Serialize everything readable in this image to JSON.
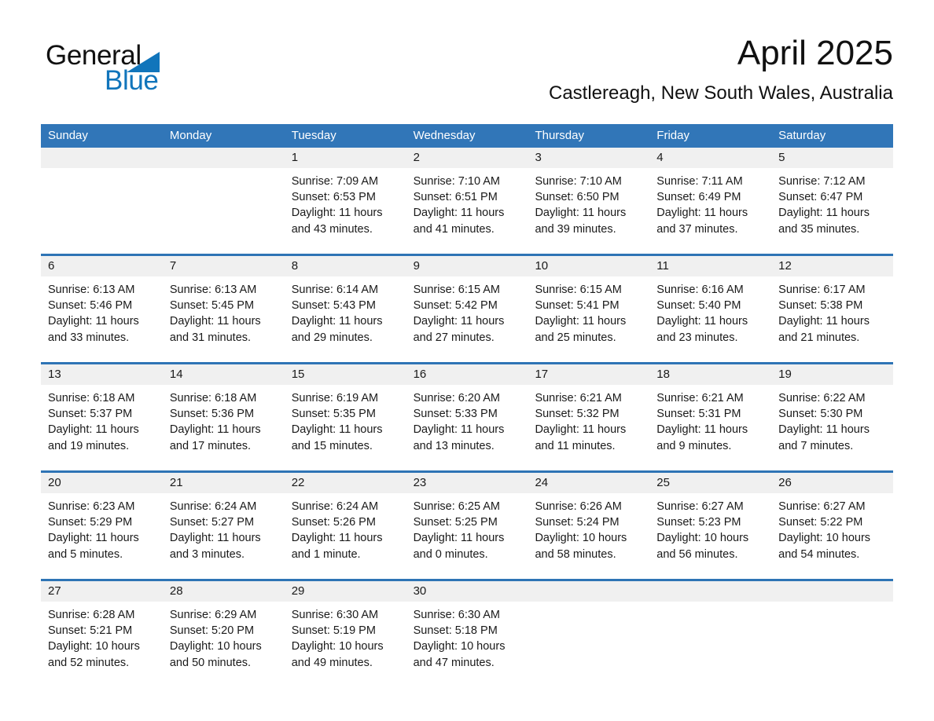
{
  "brand": {
    "logo_text_top": "General",
    "logo_text_bottom": "Blue",
    "logo_black": "#111111",
    "logo_blue": "#1175bb",
    "triangle_icon": "triangle-right-icon"
  },
  "header": {
    "title": "April 2025",
    "subtitle": "Castlereagh, New South Wales, Australia"
  },
  "colors": {
    "header_blue": "#3176b8",
    "row_rule_blue": "#2e74b5",
    "daynum_band_gray": "#f0f0f0",
    "text": "#1a1a1a",
    "header_text": "#ffffff"
  },
  "weekdays": [
    "Sunday",
    "Monday",
    "Tuesday",
    "Wednesday",
    "Thursday",
    "Friday",
    "Saturday"
  ],
  "weeks": [
    {
      "days": [
        {
          "num": "",
          "sunrise": "",
          "sunset": "",
          "daylight": ""
        },
        {
          "num": "",
          "sunrise": "",
          "sunset": "",
          "daylight": ""
        },
        {
          "num": "1",
          "sunrise": "Sunrise: 7:09 AM",
          "sunset": "Sunset: 6:53 PM",
          "daylight": "Daylight: 11 hours and 43 minutes."
        },
        {
          "num": "2",
          "sunrise": "Sunrise: 7:10 AM",
          "sunset": "Sunset: 6:51 PM",
          "daylight": "Daylight: 11 hours and 41 minutes."
        },
        {
          "num": "3",
          "sunrise": "Sunrise: 7:10 AM",
          "sunset": "Sunset: 6:50 PM",
          "daylight": "Daylight: 11 hours and 39 minutes."
        },
        {
          "num": "4",
          "sunrise": "Sunrise: 7:11 AM",
          "sunset": "Sunset: 6:49 PM",
          "daylight": "Daylight: 11 hours and 37 minutes."
        },
        {
          "num": "5",
          "sunrise": "Sunrise: 7:12 AM",
          "sunset": "Sunset: 6:47 PM",
          "daylight": "Daylight: 11 hours and 35 minutes."
        }
      ]
    },
    {
      "days": [
        {
          "num": "6",
          "sunrise": "Sunrise: 6:13 AM",
          "sunset": "Sunset: 5:46 PM",
          "daylight": "Daylight: 11 hours and 33 minutes."
        },
        {
          "num": "7",
          "sunrise": "Sunrise: 6:13 AM",
          "sunset": "Sunset: 5:45 PM",
          "daylight": "Daylight: 11 hours and 31 minutes."
        },
        {
          "num": "8",
          "sunrise": "Sunrise: 6:14 AM",
          "sunset": "Sunset: 5:43 PM",
          "daylight": "Daylight: 11 hours and 29 minutes."
        },
        {
          "num": "9",
          "sunrise": "Sunrise: 6:15 AM",
          "sunset": "Sunset: 5:42 PM",
          "daylight": "Daylight: 11 hours and 27 minutes."
        },
        {
          "num": "10",
          "sunrise": "Sunrise: 6:15 AM",
          "sunset": "Sunset: 5:41 PM",
          "daylight": "Daylight: 11 hours and 25 minutes."
        },
        {
          "num": "11",
          "sunrise": "Sunrise: 6:16 AM",
          "sunset": "Sunset: 5:40 PM",
          "daylight": "Daylight: 11 hours and 23 minutes."
        },
        {
          "num": "12",
          "sunrise": "Sunrise: 6:17 AM",
          "sunset": "Sunset: 5:38 PM",
          "daylight": "Daylight: 11 hours and 21 minutes."
        }
      ]
    },
    {
      "days": [
        {
          "num": "13",
          "sunrise": "Sunrise: 6:18 AM",
          "sunset": "Sunset: 5:37 PM",
          "daylight": "Daylight: 11 hours and 19 minutes."
        },
        {
          "num": "14",
          "sunrise": "Sunrise: 6:18 AM",
          "sunset": "Sunset: 5:36 PM",
          "daylight": "Daylight: 11 hours and 17 minutes."
        },
        {
          "num": "15",
          "sunrise": "Sunrise: 6:19 AM",
          "sunset": "Sunset: 5:35 PM",
          "daylight": "Daylight: 11 hours and 15 minutes."
        },
        {
          "num": "16",
          "sunrise": "Sunrise: 6:20 AM",
          "sunset": "Sunset: 5:33 PM",
          "daylight": "Daylight: 11 hours and 13 minutes."
        },
        {
          "num": "17",
          "sunrise": "Sunrise: 6:21 AM",
          "sunset": "Sunset: 5:32 PM",
          "daylight": "Daylight: 11 hours and 11 minutes."
        },
        {
          "num": "18",
          "sunrise": "Sunrise: 6:21 AM",
          "sunset": "Sunset: 5:31 PM",
          "daylight": "Daylight: 11 hours and 9 minutes."
        },
        {
          "num": "19",
          "sunrise": "Sunrise: 6:22 AM",
          "sunset": "Sunset: 5:30 PM",
          "daylight": "Daylight: 11 hours and 7 minutes."
        }
      ]
    },
    {
      "days": [
        {
          "num": "20",
          "sunrise": "Sunrise: 6:23 AM",
          "sunset": "Sunset: 5:29 PM",
          "daylight": "Daylight: 11 hours and 5 minutes."
        },
        {
          "num": "21",
          "sunrise": "Sunrise: 6:24 AM",
          "sunset": "Sunset: 5:27 PM",
          "daylight": "Daylight: 11 hours and 3 minutes."
        },
        {
          "num": "22",
          "sunrise": "Sunrise: 6:24 AM",
          "sunset": "Sunset: 5:26 PM",
          "daylight": "Daylight: 11 hours and 1 minute."
        },
        {
          "num": "23",
          "sunrise": "Sunrise: 6:25 AM",
          "sunset": "Sunset: 5:25 PM",
          "daylight": "Daylight: 11 hours and 0 minutes."
        },
        {
          "num": "24",
          "sunrise": "Sunrise: 6:26 AM",
          "sunset": "Sunset: 5:24 PM",
          "daylight": "Daylight: 10 hours and 58 minutes."
        },
        {
          "num": "25",
          "sunrise": "Sunrise: 6:27 AM",
          "sunset": "Sunset: 5:23 PM",
          "daylight": "Daylight: 10 hours and 56 minutes."
        },
        {
          "num": "26",
          "sunrise": "Sunrise: 6:27 AM",
          "sunset": "Sunset: 5:22 PM",
          "daylight": "Daylight: 10 hours and 54 minutes."
        }
      ]
    },
    {
      "days": [
        {
          "num": "27",
          "sunrise": "Sunrise: 6:28 AM",
          "sunset": "Sunset: 5:21 PM",
          "daylight": "Daylight: 10 hours and 52 minutes."
        },
        {
          "num": "28",
          "sunrise": "Sunrise: 6:29 AM",
          "sunset": "Sunset: 5:20 PM",
          "daylight": "Daylight: 10 hours and 50 minutes."
        },
        {
          "num": "29",
          "sunrise": "Sunrise: 6:30 AM",
          "sunset": "Sunset: 5:19 PM",
          "daylight": "Daylight: 10 hours and 49 minutes."
        },
        {
          "num": "30",
          "sunrise": "Sunrise: 6:30 AM",
          "sunset": "Sunset: 5:18 PM",
          "daylight": "Daylight: 10 hours and 47 minutes."
        },
        {
          "num": "",
          "sunrise": "",
          "sunset": "",
          "daylight": ""
        },
        {
          "num": "",
          "sunrise": "",
          "sunset": "",
          "daylight": ""
        },
        {
          "num": "",
          "sunrise": "",
          "sunset": "",
          "daylight": ""
        }
      ]
    }
  ]
}
